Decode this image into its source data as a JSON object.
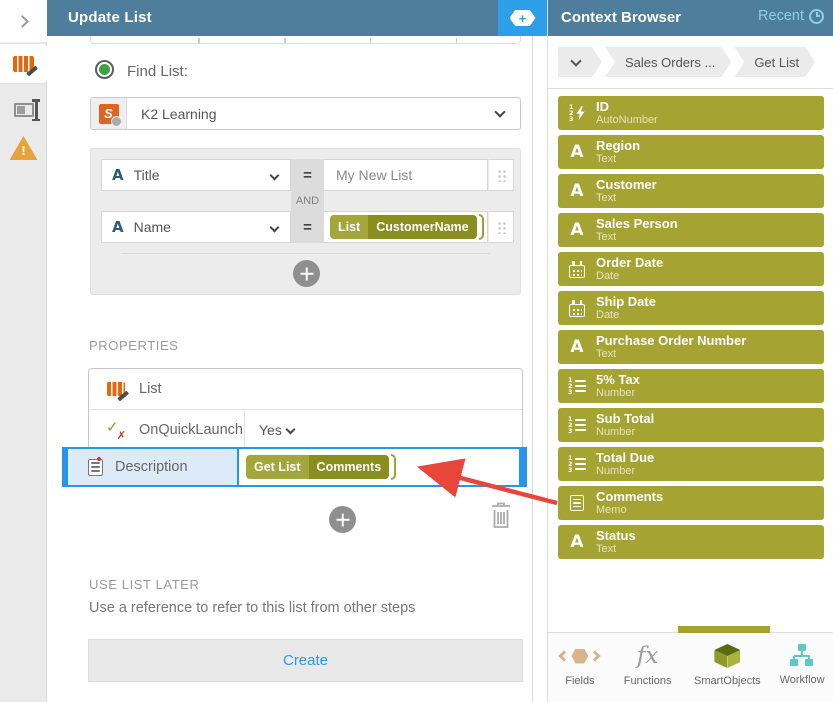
{
  "colors": {
    "header_bar": "#4e7e9c",
    "accent_blue": "#2c9fe8",
    "selection_blue": "#2796e8",
    "olive": "#a5a433",
    "arrow_red": "#e8463a"
  },
  "left_panel": {
    "title": "Update List",
    "find_list": {
      "label": "Find List:",
      "smartobject_value": "K2 Learning"
    },
    "conditions": {
      "join_label": "AND",
      "rows": [
        {
          "field": "Title",
          "operator": "=",
          "value": "My New List"
        },
        {
          "field": "Name",
          "operator": "=",
          "tag_segments": [
            "List",
            "CustomerName"
          ]
        }
      ]
    },
    "properties": {
      "heading": "PROPERTIES",
      "rows": [
        {
          "label": "List"
        },
        {
          "label": "OnQuickLaunch",
          "value": "Yes"
        },
        {
          "label": "Description",
          "tag_segments": [
            "Get List",
            "Comments"
          ]
        }
      ]
    },
    "use_list_later": {
      "heading": "USE LIST LATER",
      "description": "Use a reference to refer to this list from other steps",
      "create_label": "Create"
    }
  },
  "context_browser": {
    "title": "Context Browser",
    "recent_label": "Recent",
    "breadcrumb": [
      "Sales Orders ...",
      "Get List"
    ],
    "fields": [
      {
        "name": "ID",
        "type": "AutoNumber",
        "icon": "autonumber-icon"
      },
      {
        "name": "Region",
        "type": "Text",
        "icon": "text-icon"
      },
      {
        "name": "Customer",
        "type": "Text",
        "icon": "text-icon"
      },
      {
        "name": "Sales Person",
        "type": "Text",
        "icon": "text-icon"
      },
      {
        "name": "Order Date",
        "type": "Date",
        "icon": "calendar-icon"
      },
      {
        "name": "Ship Date",
        "type": "Date",
        "icon": "calendar-icon"
      },
      {
        "name": "Purchase Order Number",
        "type": "Text",
        "icon": "text-icon"
      },
      {
        "name": "5% Tax",
        "type": "Number",
        "icon": "number-icon"
      },
      {
        "name": "Sub Total",
        "type": "Number",
        "icon": "number-icon"
      },
      {
        "name": "Total Due",
        "type": "Number",
        "icon": "number-icon"
      },
      {
        "name": "Comments",
        "type": "Memo",
        "icon": "memo-icon"
      },
      {
        "name": "Status",
        "type": "Text",
        "icon": "text-icon"
      }
    ],
    "tabs": [
      {
        "label": "Fields",
        "icon": "fields-hexagon-icon",
        "active": false
      },
      {
        "label": "Functions",
        "icon": "fx-icon",
        "active": false
      },
      {
        "label": "SmartObjects",
        "icon": "smartobject-cube-icon",
        "active": true
      },
      {
        "label": "Workflow",
        "icon": "workflow-tree-icon",
        "active": false
      }
    ]
  }
}
